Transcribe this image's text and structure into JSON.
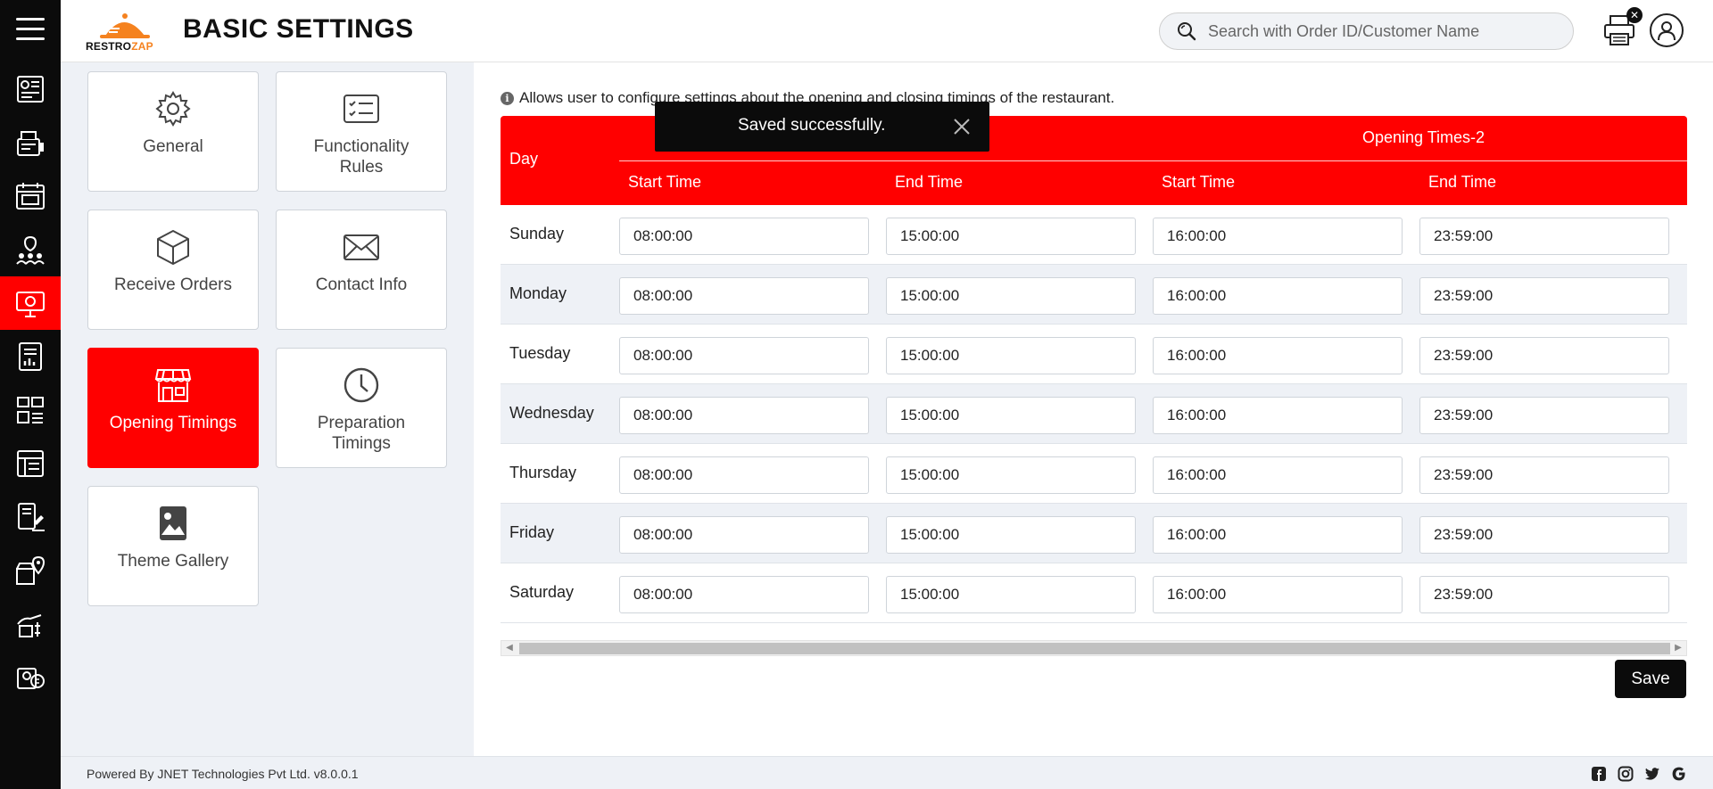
{
  "header": {
    "title": "BASIC SETTINGS",
    "logo_text_1": "RESTRO",
    "logo_text_2": "ZAP",
    "search_placeholder": "Search with Order ID/Customer Name",
    "printer_badge": "✕"
  },
  "rail": {
    "items": [
      "dashboard-icon",
      "pos-icon",
      "calendar-icon",
      "customers-icon",
      "settings-monitor-icon",
      "reports-icon",
      "inventory-icon",
      "menu-builder-icon",
      "orders-icon",
      "store-location-icon",
      "payments-icon",
      "billing-icon"
    ],
    "active_index": 4
  },
  "tiles": [
    {
      "label": "General",
      "icon": "gear-icon"
    },
    {
      "label": "Functionality Rules",
      "icon": "checklist-icon"
    },
    {
      "label": "Receive Orders",
      "icon": "box-icon"
    },
    {
      "label": "Contact Info",
      "icon": "envelope-icon"
    },
    {
      "label": "Opening Timings",
      "icon": "store-icon",
      "active": true
    },
    {
      "label": "Preparation Timings",
      "icon": "clock-icon"
    },
    {
      "label": "Theme Gallery",
      "icon": "image-icon"
    }
  ],
  "main": {
    "info_text": "Allows user to configure settings about the opening and closing timings of the restaurant.",
    "table": {
      "day_header": "Day",
      "group_2_header": "Opening Times-2",
      "sub_headers": [
        "Start Time",
        "End Time",
        "Start Time",
        "End Time"
      ],
      "rows": [
        {
          "day": "Sunday",
          "times": [
            "08:00:00",
            "15:00:00",
            "16:00:00",
            "23:59:00"
          ]
        },
        {
          "day": "Monday",
          "times": [
            "08:00:00",
            "15:00:00",
            "16:00:00",
            "23:59:00"
          ]
        },
        {
          "day": "Tuesday",
          "times": [
            "08:00:00",
            "15:00:00",
            "16:00:00",
            "23:59:00"
          ]
        },
        {
          "day": "Wednesday",
          "times": [
            "08:00:00",
            "15:00:00",
            "16:00:00",
            "23:59:00"
          ]
        },
        {
          "day": "Thursday",
          "times": [
            "08:00:00",
            "15:00:00",
            "16:00:00",
            "23:59:00"
          ]
        },
        {
          "day": "Friday",
          "times": [
            "08:00:00",
            "15:00:00",
            "16:00:00",
            "23:59:00"
          ]
        },
        {
          "day": "Saturday",
          "times": [
            "08:00:00",
            "15:00:00",
            "16:00:00",
            "23:59:00"
          ]
        }
      ]
    },
    "save_label": "Save"
  },
  "toast": {
    "message": "Saved successfully."
  },
  "footer": {
    "copyright": "Powered By JNET Technologies Pvt Ltd. v8.0.0.1",
    "social": [
      "facebook-icon",
      "instagram-icon",
      "twitter-icon",
      "google-icon"
    ]
  },
  "colors": {
    "accent": "#ff0000",
    "dark": "#0b0b0b",
    "panel_bg": "#eef1f6",
    "brand_orange": "#f5821f"
  }
}
